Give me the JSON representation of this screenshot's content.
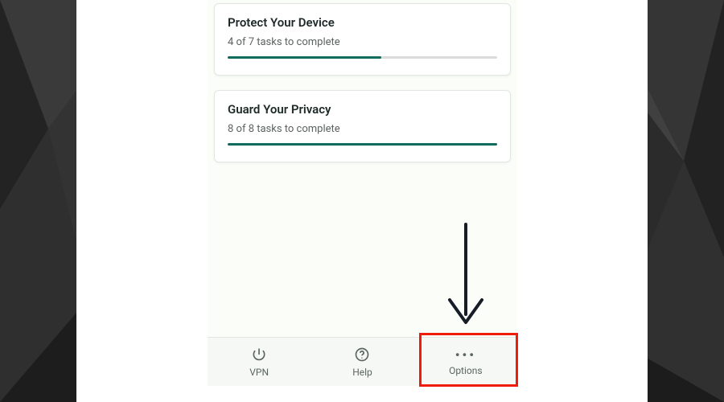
{
  "cards": {
    "protect": {
      "title": "Protect Your Device",
      "subtitle": "4 of 7 tasks to complete",
      "done": 4,
      "total": 7
    },
    "privacy": {
      "title": "Guard Your Privacy",
      "subtitle": "8 of 8 tasks to complete",
      "done": 8,
      "total": 8
    }
  },
  "tabs": {
    "vpn": {
      "label": "VPN"
    },
    "help": {
      "label": "Help"
    },
    "options": {
      "label": "Options"
    }
  },
  "colors": {
    "accent": "#0f6b5c",
    "annotation": "#ef1c0c"
  }
}
